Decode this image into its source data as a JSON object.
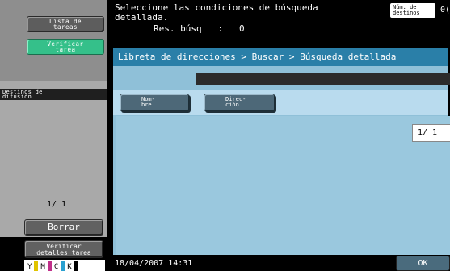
{
  "left": {
    "job_list": "Lista de\ntareas",
    "check_job": "Verificar\ntarea",
    "broadcast_dest": "Destinos de\ndifusión",
    "page_counter": "1/  1",
    "delete_btn": "Borrar",
    "check_details": "Verificar\ndetalles tarea",
    "toner": {
      "labels": [
        "Y",
        "M",
        "C",
        "K"
      ],
      "colors": [
        "#e0c400",
        "#c0308a",
        "#2aa0d0",
        "#000000"
      ]
    }
  },
  "header": {
    "message_line1": "Seleccione las condiciones de búsqueda",
    "message_line2": "detallada.",
    "results_label": "Res. búsq",
    "results_sep": ":",
    "results_value": "0",
    "num_dest_label": "Núm. de\ndestinos",
    "num_dest_value": "0("
  },
  "main": {
    "breadcrumb": "Libreta de direcciones > Buscar > Búsqueda detallada",
    "name_btn": "Nom-\nbre",
    "address_btn": "Direc-\nción",
    "page_counter": "1/  1"
  },
  "footer": {
    "datetime": "18/04/2007   14:31",
    "ok_btn": "OK"
  },
  "colors": {
    "accent": "#2a7fa8",
    "green_button": "#35c08a"
  }
}
